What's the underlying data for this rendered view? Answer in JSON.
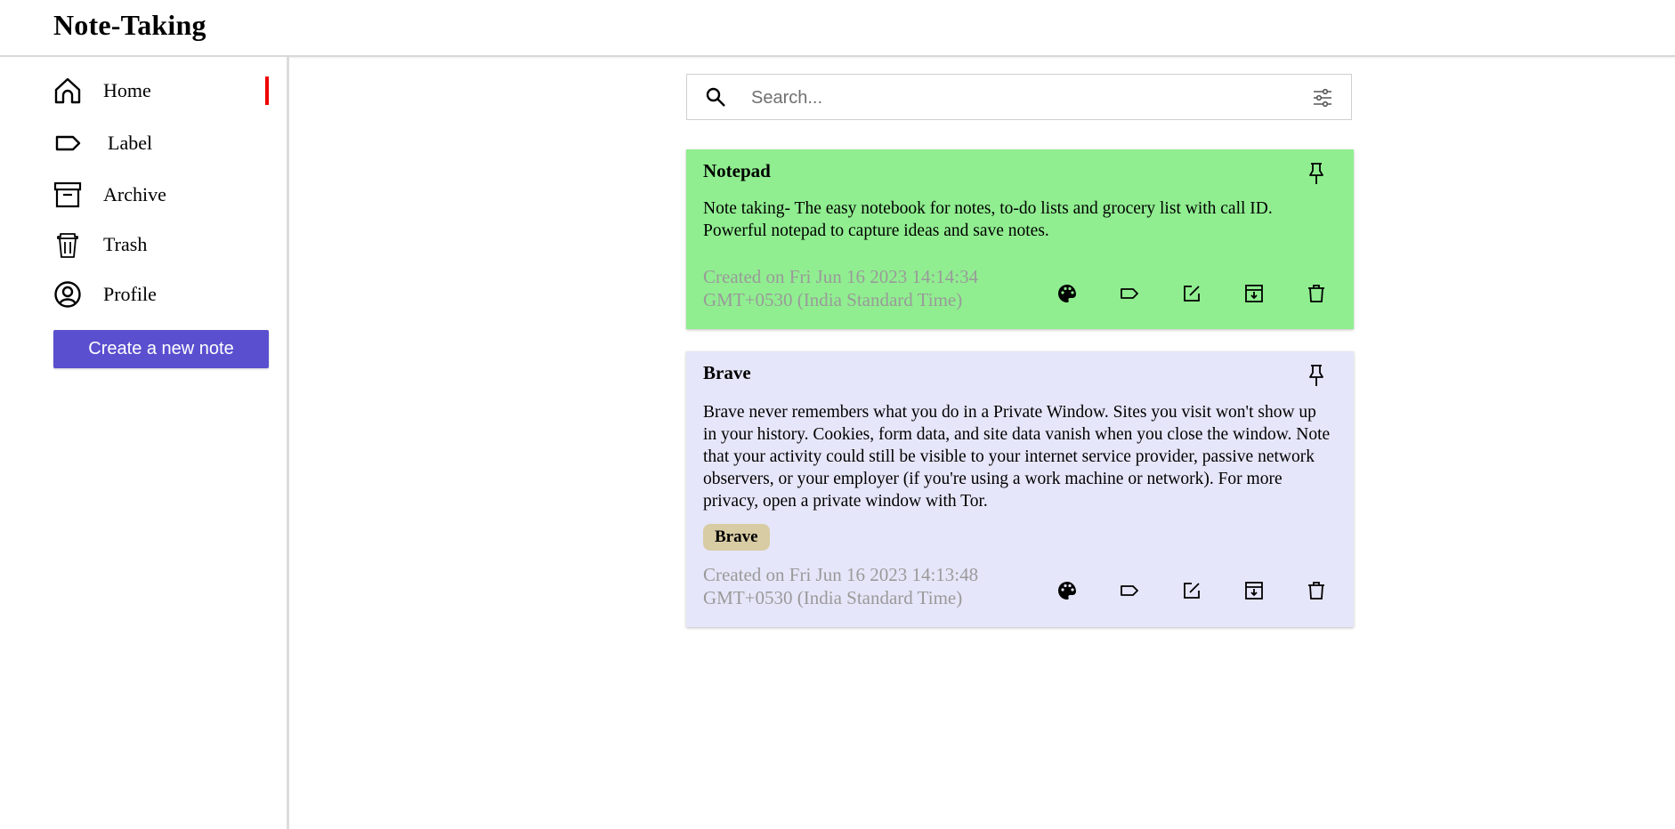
{
  "app": {
    "title": "Note-Taking"
  },
  "sidebar": {
    "items": [
      {
        "label": "Home",
        "icon": "home-icon",
        "active": true
      },
      {
        "label": "Label",
        "icon": "label-icon"
      },
      {
        "label": "Archive",
        "icon": "archive-icon"
      },
      {
        "label": "Trash",
        "icon": "trash-icon"
      },
      {
        "label": "Profile",
        "icon": "profile-icon"
      }
    ],
    "create_label": "Create a new note",
    "active_color": "#ee0000",
    "button_color": "#5a4fcf"
  },
  "search": {
    "placeholder": "Search...",
    "value": ""
  },
  "notes": [
    {
      "title": "Notepad",
      "body": "Note taking- The easy notebook for notes, to-do lists and grocery list with call ID. Powerful notepad to capture ideas and save notes.",
      "created": "Created on Fri Jun 16 2023 14:14:34 GMT+0530 (India Standard Time)",
      "color": "#90ee90",
      "tags": []
    },
    {
      "title": "Brave",
      "body": "Brave never remembers what you do in a Private Window. Sites you visit won't show up in your history. Cookies, form data, and site data vanish when you close the window. Note that your activity could still be visible to your internet service provider, passive network observers, or your employer (if you're using a work machine or network). For more privacy, open a private window with Tor.",
      "created": "Created on Fri Jun 16 2023 14:13:48 GMT+0530 (India Standard Time)",
      "color": "#e6e6fa",
      "tags": [
        "Brave"
      ]
    }
  ],
  "note_actions": [
    "palette-icon",
    "label-icon",
    "edit-icon",
    "archive-icon",
    "trash-icon"
  ]
}
